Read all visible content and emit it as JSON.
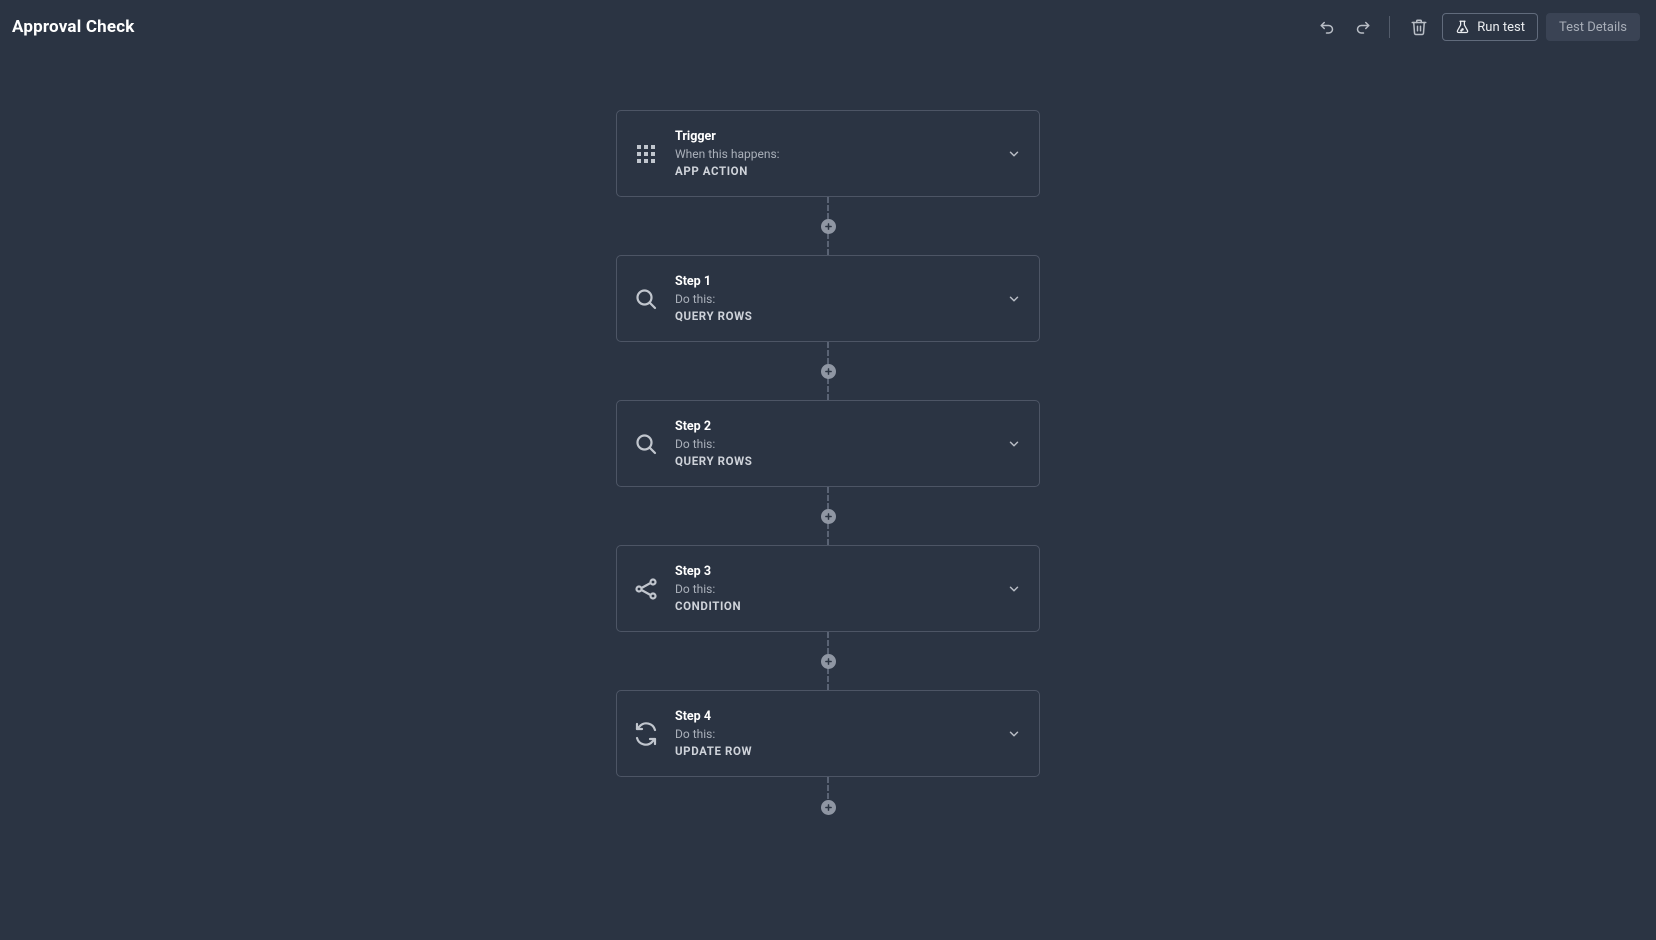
{
  "header": {
    "title": "Approval Check",
    "run_test_label": "Run test",
    "test_details_label": "Test Details"
  },
  "flow": {
    "trigger": {
      "title": "Trigger",
      "subtitle": "When this happens:",
      "action": "APP ACTION",
      "icon": "grid-icon"
    },
    "steps": [
      {
        "title": "Step 1",
        "subtitle": "Do this:",
        "action": "QUERY ROWS",
        "icon": "search-icon"
      },
      {
        "title": "Step 2",
        "subtitle": "Do this:",
        "action": "QUERY ROWS",
        "icon": "search-icon"
      },
      {
        "title": "Step 3",
        "subtitle": "Do this:",
        "action": "CONDITION",
        "icon": "branch-icon"
      },
      {
        "title": "Step 4",
        "subtitle": "Do this:",
        "action": "UPDATE ROW",
        "icon": "refresh-icon"
      }
    ]
  }
}
